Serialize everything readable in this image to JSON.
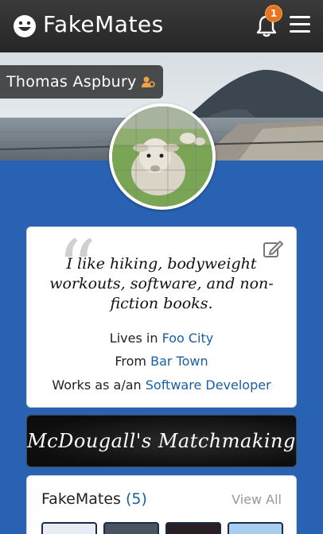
{
  "header": {
    "brand": "FakeMates",
    "notification_count": "1",
    "logo_icon": "smiley-icon",
    "bell_icon": "bell-icon",
    "menu_icon": "hamburger-menu-icon"
  },
  "profile": {
    "name": "Thomas Aspbury",
    "name_icon": "user-settings-icon",
    "bio": "I like hiking, bodyweight workouts, software, and non-fiction books.",
    "lives_prefix": "Lives in",
    "lives_value": "Foo City",
    "from_prefix": "From",
    "from_value": "Bar Town",
    "works_prefix": "Works as a/an",
    "works_value": "Software Developer",
    "edit_icon": "edit-icon"
  },
  "matchmaking": {
    "label": "McDougall's Matchmaking"
  },
  "mates": {
    "title": "FakeMates",
    "count": "(5)",
    "view_all": "View All"
  },
  "colors": {
    "header_bg": "#2e2e2e",
    "page_bg": "#2a62b3",
    "link": "#1a5fa3",
    "badge": "#e8741f"
  }
}
